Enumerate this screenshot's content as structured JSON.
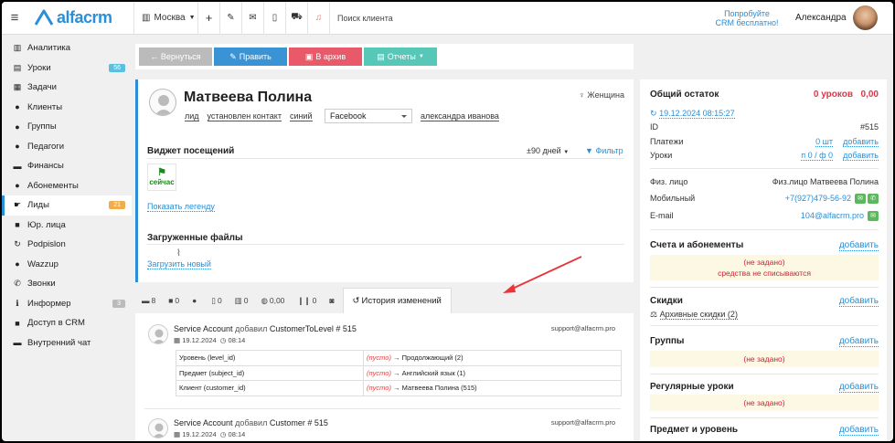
{
  "topbar": {
    "logo_text": "alfacrm",
    "branch": "Москва",
    "search_placeholder": "Поиск клиента",
    "promo_line1": "Попробуйте",
    "promo_line2": "CRM бесплатно!",
    "user_name": "Александра"
  },
  "sidebar": {
    "items": [
      {
        "icon": "chart-icon",
        "glyph": "▥",
        "label": "Аналитика"
      },
      {
        "icon": "graduation-icon",
        "glyph": "▤",
        "label": "Уроки",
        "badge": "56",
        "badge_color": "#5bc0de"
      },
      {
        "icon": "calendar-icon",
        "glyph": "▦",
        "label": "Задачи"
      },
      {
        "icon": "user-icon",
        "glyph": "●",
        "label": "Клиенты"
      },
      {
        "icon": "users-icon",
        "glyph": "●",
        "label": "Группы"
      },
      {
        "icon": "teacher-icon",
        "glyph": "●",
        "label": "Педагоги"
      },
      {
        "icon": "money-icon",
        "glyph": "▬",
        "label": "Финансы"
      },
      {
        "icon": "ticket-icon",
        "glyph": "●",
        "label": "Абонементы"
      },
      {
        "icon": "hand-icon",
        "glyph": "☛",
        "label": "Лиды",
        "badge": "21",
        "badge_color": "#f0ad4e",
        "active": true
      },
      {
        "icon": "building-icon",
        "glyph": "■",
        "label": "Юр. лица"
      },
      {
        "icon": "refresh-icon",
        "glyph": "↻",
        "label": "Podpislon"
      },
      {
        "icon": "whatsapp-icon",
        "glyph": "●",
        "label": "Wazzup"
      },
      {
        "icon": "phone-icon",
        "glyph": "✆",
        "label": "Звонки"
      },
      {
        "icon": "info-icon",
        "glyph": "ℹ",
        "label": "Информер",
        "badge": "3",
        "badge_color": "#bbbbbb"
      },
      {
        "icon": "lock-icon",
        "glyph": "■",
        "label": "Доступ в CRM"
      },
      {
        "icon": "chat-icon",
        "glyph": "▬",
        "label": "Внутренний чат"
      }
    ]
  },
  "toolbar": {
    "back": "← Вернуться",
    "edit": "Править",
    "archive": "В архив",
    "reports": "Отчеты"
  },
  "client": {
    "name": "Матвеева Полина",
    "gender": "Женщина",
    "tag1": "лид",
    "tag2": "установлен контакт",
    "tag3": "синий",
    "source": "Facebook",
    "agent": "александра иванова"
  },
  "visits": {
    "title": "Виджет посещений",
    "range": "±90 дней",
    "filter": "Фильтр",
    "now": "сейчас",
    "legend": "Показать легенду"
  },
  "files": {
    "title": "Загруженные файлы",
    "upload": "Загрузить новый"
  },
  "tabs": [
    {
      "icon": "comments-icon",
      "label": "8"
    },
    {
      "icon": "tasks-icon",
      "label": "0"
    },
    {
      "icon": "whatsapp-icon",
      "label": ""
    },
    {
      "icon": "doc-icon",
      "label": "0"
    },
    {
      "icon": "chart-icon",
      "label": "0"
    },
    {
      "icon": "money-icon",
      "label": "0,00"
    },
    {
      "icon": "pause-icon",
      "label": "0"
    },
    {
      "icon": "camera-icon",
      "label": ""
    }
  ],
  "active_tab": "История изменений",
  "history": [
    {
      "title_user": "Service Account",
      "title_action": "добавил",
      "title_object": "CustomerToLevel # 515",
      "date": "19.12.2024",
      "time": "08:14",
      "email": "support@alfacrm.pro",
      "changes": [
        {
          "field": "Уровень (level_id)",
          "from": "(пусто)",
          "to": "Продолжающий (2)"
        },
        {
          "field": "Предмет (subject_id)",
          "from": "(пусто)",
          "to": "Английский язык (1)"
        },
        {
          "field": "Клиент (customer_id)",
          "from": "(пусто)",
          "to": "Матвеева Полина (515)"
        }
      ]
    },
    {
      "title_user": "Service Account",
      "title_action": "добавил",
      "title_object": "Customer # 515",
      "date": "19.12.2024",
      "time": "08:14",
      "email": "support@alfacrm.pro"
    }
  ],
  "right": {
    "balance_label": "Общий остаток",
    "balance_lessons": "0 уроков",
    "balance_money": "0,00",
    "datetime": "19.12.2024 08:15:27",
    "id_label": "ID",
    "id_value": "#515",
    "payments_label": "Платежи",
    "payments_value": "0 шт",
    "lessons_label": "Уроки",
    "lessons_value": "п 0 / ф 0",
    "add": "добавить",
    "person_label": "Физ. лицо",
    "person_value": "Физ.лицо Матвеева Полина",
    "mobile_label": "Мобильный",
    "mobile_value": "+7(927)479-56-92",
    "email_label": "E-mail",
    "email_value": "104@alfacrm.pro",
    "accounts_title": "Счета и абонементы",
    "not_set": "(не задано)",
    "no_charge": "средства не списываются",
    "discounts_title": "Скидки",
    "discounts_archive": "Архивные скидки (2)",
    "groups_title": "Группы",
    "regular_title": "Регулярные уроки",
    "subject_title": "Предмет и уровень"
  }
}
